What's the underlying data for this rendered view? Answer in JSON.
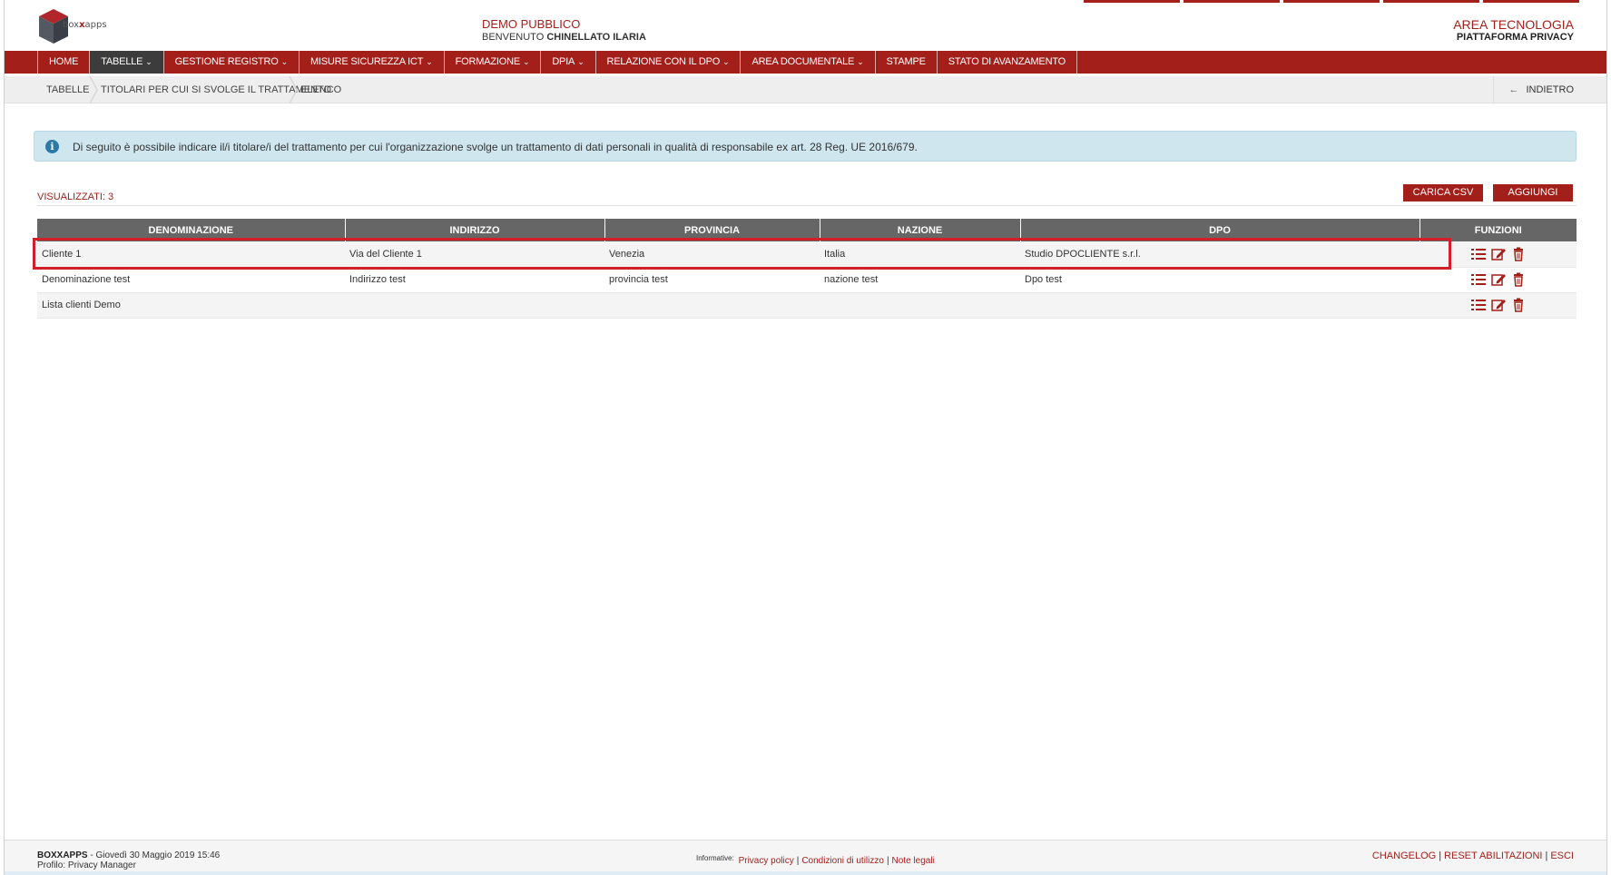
{
  "header": {
    "logo_prefix": "box",
    "logo_mid": "x",
    "logo_suffix": "apps",
    "center_line1": "DEMO PUBBLICO",
    "center_line2_prefix": "BENVENUTO",
    "center_line2_user": "CHINELLATO ILARIA",
    "right_line1": "AREA TECNOLOGIA",
    "right_line2": "PIATTAFORMA PRIVACY"
  },
  "nav": {
    "items": [
      {
        "label": "HOME",
        "dropdown": false
      },
      {
        "label": "TABELLE",
        "dropdown": true,
        "active": true
      },
      {
        "label": "GESTIONE REGISTRO",
        "dropdown": true
      },
      {
        "label": "MISURE SICUREZZA ICT",
        "dropdown": true
      },
      {
        "label": "FORMAZIONE",
        "dropdown": true
      },
      {
        "label": "DPIA",
        "dropdown": true
      },
      {
        "label": "RELAZIONE CON IL DPO",
        "dropdown": true
      },
      {
        "label": "AREA DOCUMENTALE",
        "dropdown": true
      },
      {
        "label": "STAMPE",
        "dropdown": false
      },
      {
        "label": "STATO DI AVANZAMENTO",
        "dropdown": false
      }
    ]
  },
  "breadcrumb": {
    "items": [
      "TABELLE",
      "TITOLARI PER CUI SI SVOLGE IL TRATTAMENTO",
      "ELENCO"
    ],
    "back_label": "INDIETRO"
  },
  "info": {
    "text": "Di seguito è possibile indicare il/i titolare/i del trattamento per cui l'organizzazione svolge un trattamento di dati personali in qualità di responsabile ex art. 28 Reg. UE 2016/679."
  },
  "toolbar": {
    "count_label": "VISUALIZZATI: 3",
    "csv_button": "CARICA CSV",
    "add_button": "AGGIUNGI"
  },
  "table": {
    "columns": [
      "DENOMINAZIONE",
      "INDIRIZZO",
      "PROVINCIA",
      "NAZIONE",
      "DPO",
      "FUNZIONI"
    ],
    "rows": [
      [
        "Cliente 1",
        "Via del Cliente 1",
        "Venezia",
        "Italia",
        "Studio DPOCLIENTE s.r.l."
      ],
      [
        "Denominazione test",
        "Indirizzo test",
        "provincia test",
        "nazione test",
        "Dpo test"
      ],
      [
        "Lista clienti Demo",
        "",
        "",
        "",
        ""
      ]
    ],
    "row_icons": [
      "list-icon",
      "edit-icon",
      "trash-icon"
    ]
  },
  "footer": {
    "brand": "BOXXAPPS",
    "datetime": " - Giovedì 30 Maggio 2019 15:46",
    "profile": "Profilo: Privacy Manager",
    "info_label": "Informative:",
    "privacy": "Privacy policy",
    "conditions": "Condizioni di utilizzo",
    "legal": "Note legali",
    "changelog": "CHANGELOG",
    "reset": "RESET ABILITAZIONI",
    "exit": "ESCI"
  },
  "colors": {
    "brand_red": "#a31f1a",
    "nav_active": "#3c3c3c",
    "table_header": "#666666",
    "info_bg": "#cfe6ef",
    "highlight": "#d2202a"
  }
}
